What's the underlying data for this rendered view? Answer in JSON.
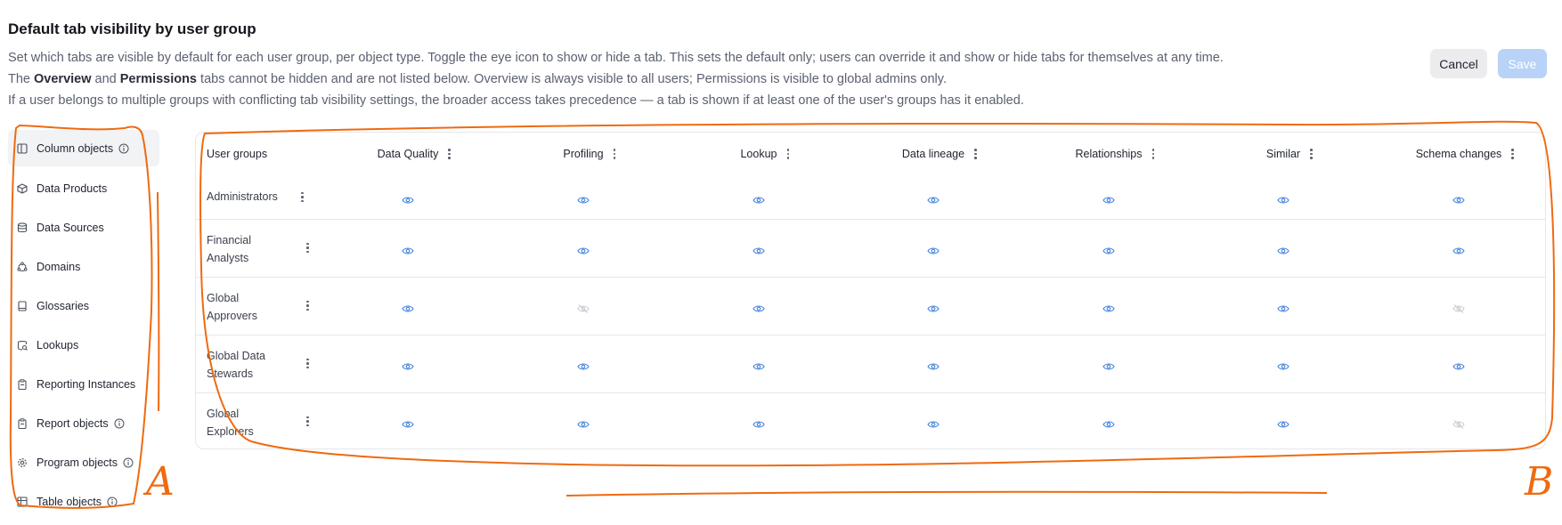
{
  "page": {
    "title": "Default tab visibility by user group",
    "desc_line1": "Set which tabs are visible by default for each user group, per object type. Toggle the eye icon to show or hide a tab. This sets the default only; users can override it and show or hide tabs for themselves at any time.",
    "desc_line2_a": "The ",
    "desc_line2_b": "Overview",
    "desc_line2_c": " and ",
    "desc_line2_d": "Permissions",
    "desc_line2_e": " tabs cannot be hidden and are not listed below. Overview is always visible to all users; Permissions is visible to global admins only.",
    "desc_line3": "If a user belongs to multiple groups with conflicting tab visibility settings, the broader access takes precedence — a tab is shown if at least one of the user's groups has it enabled."
  },
  "actions": {
    "cancel_label": "Cancel",
    "save_label": "Save"
  },
  "sidebar": {
    "items": [
      {
        "label": "Column objects",
        "icon": "columns-icon",
        "info": true,
        "active": true
      },
      {
        "label": "Data Products",
        "icon": "cube-icon",
        "info": false
      },
      {
        "label": "Data Sources",
        "icon": "database-icon",
        "info": false
      },
      {
        "label": "Domains",
        "icon": "domain-icon",
        "info": false
      },
      {
        "label": "Glossaries",
        "icon": "book-icon",
        "info": false
      },
      {
        "label": "Lookups",
        "icon": "lookup-icon",
        "info": false
      },
      {
        "label": "Reporting Instances",
        "icon": "clipboard-icon",
        "info": false
      },
      {
        "label": "Report objects",
        "icon": "clipboard-icon",
        "info": true
      },
      {
        "label": "Program objects",
        "icon": "gear-icon",
        "info": true
      },
      {
        "label": "Table objects",
        "icon": "table-icon",
        "info": true
      }
    ]
  },
  "table": {
    "group_header": "User groups",
    "columns": [
      "Data Quality",
      "Profiling",
      "Lookup",
      "Data lineage",
      "Relationships",
      "Similar",
      "Schema changes"
    ],
    "rows": [
      {
        "group": "Administrators",
        "visible": [
          true,
          true,
          true,
          true,
          true,
          true,
          true
        ]
      },
      {
        "group": "Financial Analysts",
        "visible": [
          true,
          true,
          true,
          true,
          true,
          true,
          true
        ]
      },
      {
        "group": "Global Approvers",
        "visible": [
          true,
          false,
          true,
          true,
          true,
          true,
          false
        ]
      },
      {
        "group": "Global Data Stewards",
        "visible": [
          true,
          true,
          true,
          true,
          true,
          true,
          true
        ]
      },
      {
        "group": "Global Explorers",
        "visible": [
          true,
          true,
          true,
          true,
          true,
          true,
          false
        ]
      }
    ]
  },
  "annotations": {
    "label_a": "A",
    "label_b": "B"
  },
  "colors": {
    "accent": "#3d7fd9",
    "hidden": "#c9ccd2",
    "annotation": "#ef6a10",
    "save_disabled": "#b8d3f7"
  }
}
